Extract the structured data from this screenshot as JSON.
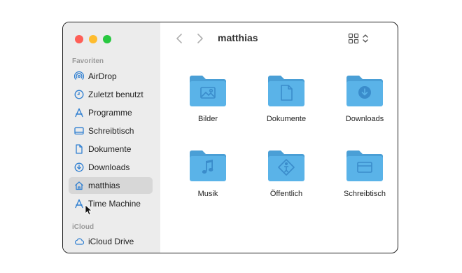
{
  "window": {
    "title": "matthias",
    "view_icon": "icon-view-grid-icon",
    "view_switch_icon": "chevron-up-down-icon"
  },
  "sidebar": {
    "favorites_title": "Favoriten",
    "icloud_title": "iCloud",
    "items": [
      {
        "label": "AirDrop",
        "icon": "airdrop-icon"
      },
      {
        "label": "Zuletzt benutzt",
        "icon": "clock-icon"
      },
      {
        "label": "Programme",
        "icon": "applications-icon"
      },
      {
        "label": "Schreibtisch",
        "icon": "desktop-icon"
      },
      {
        "label": "Dokumente",
        "icon": "document-icon"
      },
      {
        "label": "Downloads",
        "icon": "download-icon"
      },
      {
        "label": "matthias",
        "icon": "home-icon",
        "selected": true
      },
      {
        "label": "Time Machine",
        "icon": "time-machine-icon"
      }
    ],
    "icloud_items": [
      {
        "label": "iCloud Drive",
        "icon": "cloud-icon"
      }
    ]
  },
  "folders": [
    {
      "label": "Bilder",
      "icon": "photo-icon"
    },
    {
      "label": "Dokumente",
      "icon": "document-icon"
    },
    {
      "label": "Downloads",
      "icon": "download-icon"
    },
    {
      "label": "Musik",
      "icon": "music-note-icon"
    },
    {
      "label": "Öffentlich",
      "icon": "public-icon"
    },
    {
      "label": "Schreibtisch",
      "icon": "desktop-icon"
    }
  ],
  "colors": {
    "folder": "#5ab3e8",
    "folder_tab": "#4a9fd6",
    "sidebar_icon": "#2f7fd1",
    "selected_item": "#d7d7d7"
  }
}
